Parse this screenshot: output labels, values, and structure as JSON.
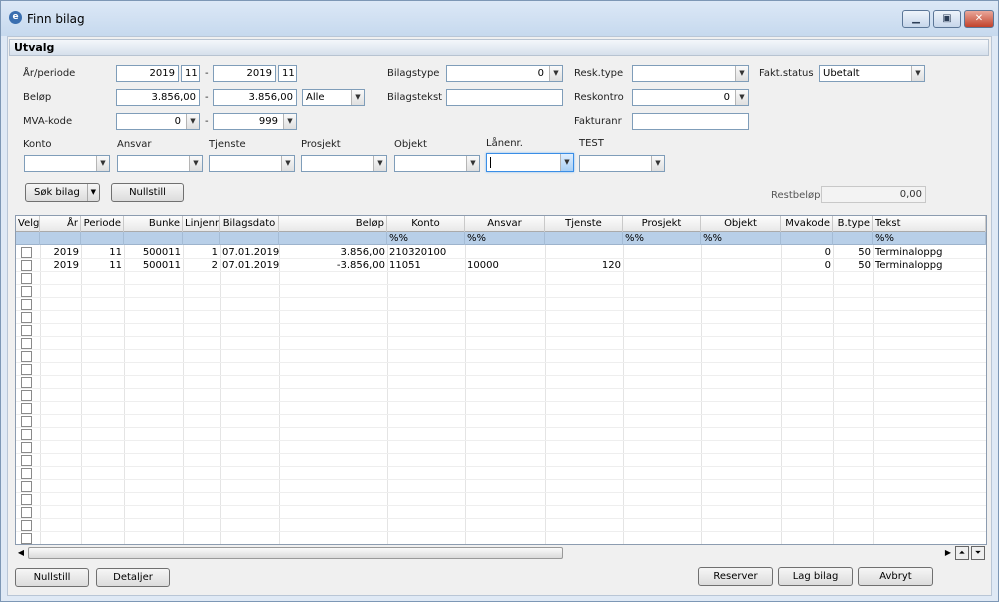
{
  "window": {
    "title": "Finn bilag"
  },
  "utvalg": {
    "header": "Utvalg",
    "ar_periode": {
      "label": "År/periode",
      "from_year": "2019",
      "from_period": "11",
      "dash": "-",
      "to_year": "2019",
      "to_period": "11"
    },
    "belop": {
      "label": "Beløp",
      "from": "3.856,00",
      "dash": "-",
      "to": "3.856,00",
      "mode": "Alle"
    },
    "mva_kode": {
      "label": "MVA-kode",
      "from": "0",
      "dash": "-",
      "to": "999"
    },
    "bilagstype": {
      "label": "Bilagstype",
      "value": "0"
    },
    "bilagstekst": {
      "label": "Bilagstekst",
      "value": ""
    },
    "resk_type": {
      "label": "Resk.type",
      "value": ""
    },
    "reskontro": {
      "label": "Reskontro",
      "value": "0"
    },
    "fakturanr": {
      "label": "Fakturanr",
      "value": ""
    },
    "fakt_status": {
      "label": "Fakt.status",
      "value": "Ubetalt"
    },
    "dims": [
      {
        "label": "Konto",
        "value": ""
      },
      {
        "label": "Ansvar",
        "value": ""
      },
      {
        "label": "Tjenste",
        "value": ""
      },
      {
        "label": "Prosjekt",
        "value": ""
      },
      {
        "label": "Objekt",
        "value": ""
      },
      {
        "label": "Lånenr.",
        "value": ""
      },
      {
        "label": "TEST",
        "value": ""
      }
    ],
    "search_button": "Søk bilag",
    "reset_button": "Nullstill",
    "restbelop": {
      "label": "Restbeløp",
      "value": "0,00"
    }
  },
  "grid": {
    "columns": [
      "Velg",
      "År",
      "Periode",
      "Bunke",
      "Linjenr",
      "Bilagsdato",
      "Beløp",
      "Konto",
      "Ansvar",
      "Tjenste",
      "Prosjekt",
      "Objekt",
      "Mvakode",
      "B.type",
      "Tekst"
    ],
    "filters": {
      "konto": "%%",
      "ansvar": "%%",
      "prosjekt": "%%",
      "objekt": "%%",
      "tekst": "%%"
    },
    "rows": [
      {
        "ar": "2019",
        "periode": "11",
        "bunke": "500011",
        "linjenr": "1",
        "bilagsdato": "07.01.2019",
        "belop": "3.856,00",
        "konto": "210320100",
        "ansvar": "",
        "tjenste": "",
        "prosjekt": "",
        "objekt": "",
        "mvakode": "0",
        "btype": "50",
        "tekst": "Terminaloppg"
      },
      {
        "ar": "2019",
        "periode": "11",
        "bunke": "500011",
        "linjenr": "2",
        "bilagsdato": "07.01.2019",
        "belop": "-3.856,00",
        "konto": "11051",
        "ansvar": "10000",
        "tjenste": "120",
        "prosjekt": "",
        "objekt": "",
        "mvakode": "0",
        "btype": "50",
        "tekst": "Terminaloppg"
      }
    ]
  },
  "footer": {
    "reset": "Nullstill",
    "details": "Detaljer",
    "reserve": "Reserver",
    "make": "Lag bilag",
    "cancel": "Avbryt"
  },
  "icons": {
    "app": "app-e-icon",
    "minimize": "minimize-icon",
    "maximize": "maximize-icon",
    "close": "close-icon"
  }
}
